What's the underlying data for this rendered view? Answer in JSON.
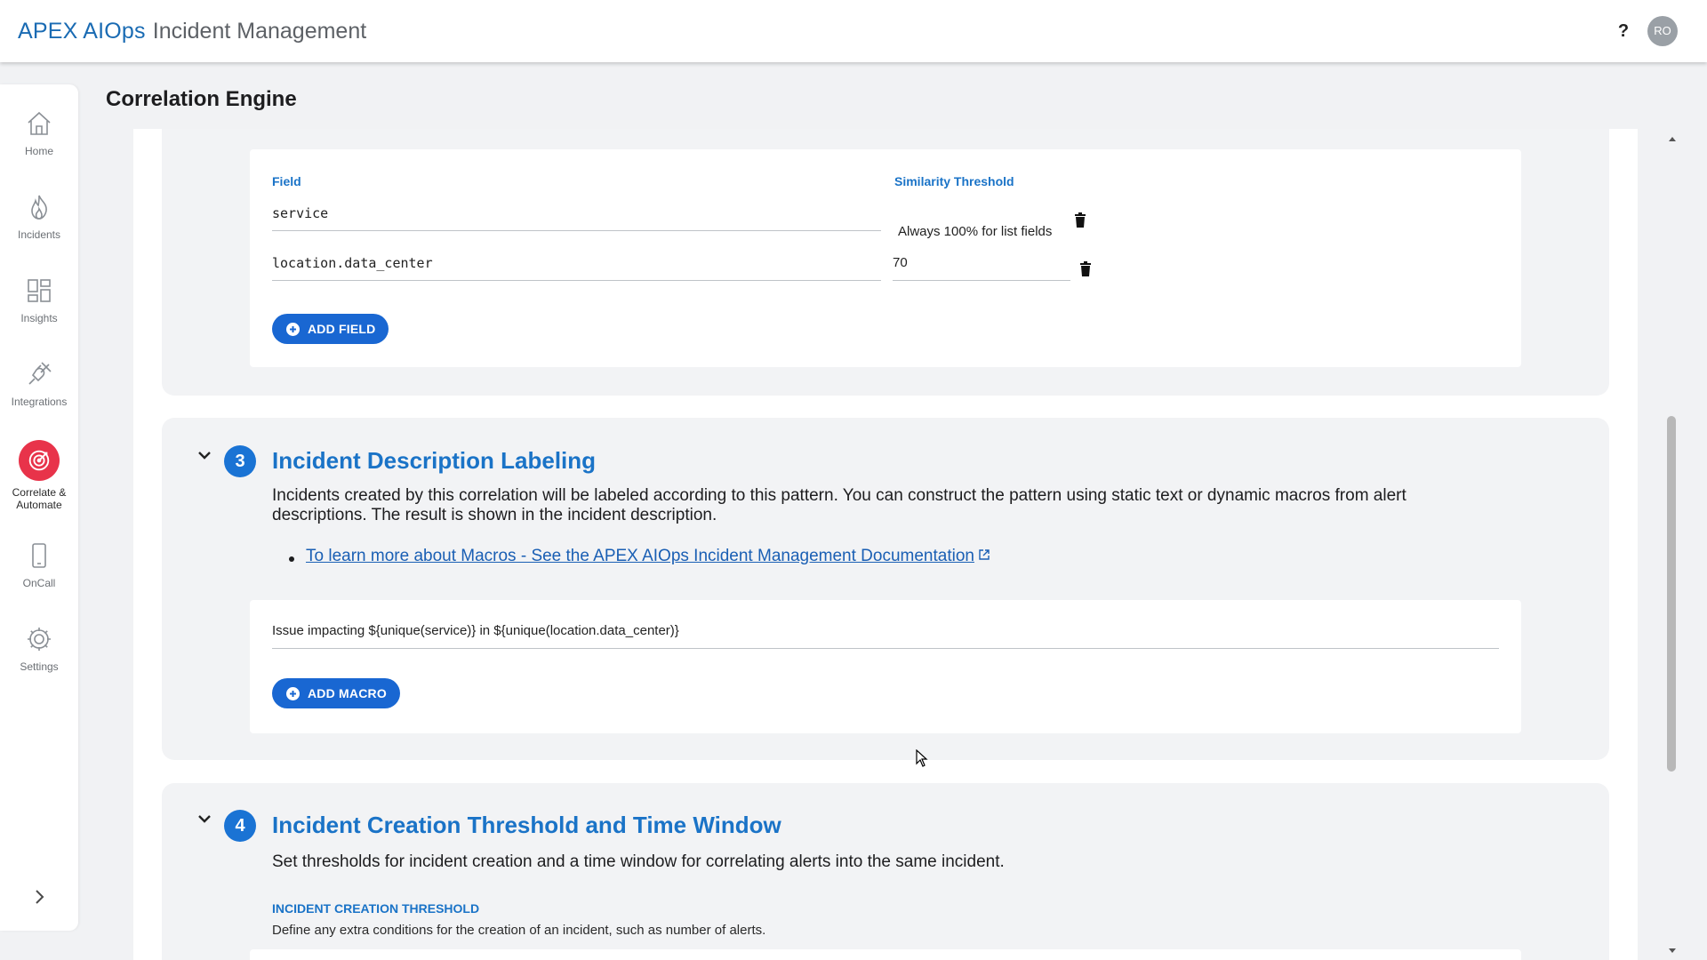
{
  "app": {
    "brand_main": "APEX AIOps",
    "brand_sub": "Incident Management",
    "help": "?",
    "user_initials": "RO"
  },
  "sidebar": {
    "items": [
      {
        "label": "Home",
        "icon": "home-icon"
      },
      {
        "label": "Incidents",
        "icon": "flame-icon"
      },
      {
        "label": "Insights",
        "icon": "dashboard-icon"
      },
      {
        "label": "Integrations",
        "icon": "plug-icon"
      },
      {
        "label": "Correlate & Automate",
        "label_line1": "Correlate &",
        "label_line2": "Automate",
        "icon": "target-icon",
        "active": true
      },
      {
        "label": "OnCall",
        "icon": "phone-icon"
      },
      {
        "label": "Settings",
        "icon": "gear-icon"
      }
    ],
    "expand_icon": "chevron-right-icon"
  },
  "page": {
    "title": "Correlation Engine"
  },
  "fields_section": {
    "field_header": "Field",
    "threshold_header": "Similarity Threshold",
    "rows": [
      {
        "field": "service",
        "threshold": "Always 100% for list fields"
      },
      {
        "field": "location.data_center",
        "threshold": "70"
      }
    ],
    "add_field_label": "ADD FIELD"
  },
  "section3": {
    "number": "3",
    "title": "Incident Description Labeling",
    "desc_line1": "Incidents created by this correlation will be labeled according to this pattern. You can construct the pattern using static text or dynamic macros from alert",
    "desc_line2": "descriptions. The result is shown in the incident description.",
    "link_text": "To learn more about Macros - See the APEX AIOps Incident Management Documentation",
    "pattern_value": "Issue impacting  ${unique(service)} in  ${unique(location.data_center)}",
    "add_macro_label": "ADD MACRO"
  },
  "section4": {
    "number": "4",
    "title": "Incident Creation Threshold and Time Window",
    "desc": "Set thresholds for incident creation and a time window for correlating alerts into the same incident.",
    "sub_head": "INCIDENT CREATION THRESHOLD",
    "sub_desc": "Define any extra conditions for the creation of an incident, such as number of alerts."
  },
  "colors": {
    "brand": "#1a6bb3",
    "accent": "#1967d2",
    "active_nav": "#e8334a"
  }
}
